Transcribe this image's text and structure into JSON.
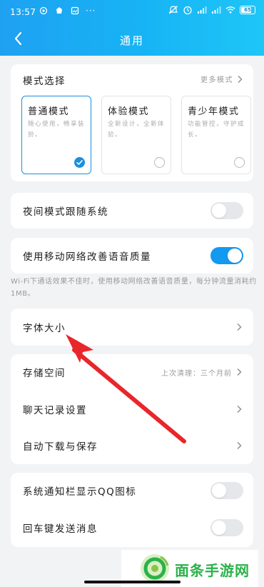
{
  "status": {
    "time": "13:57",
    "dots": "···",
    "battery": "65"
  },
  "nav": {
    "title": "通用",
    "back_icon": "chevron-left-icon"
  },
  "mode_select": {
    "title": "模式选择",
    "more": "更多模式",
    "modes": [
      {
        "name": "普通模式",
        "desc": "随心使用，畅享装扮。",
        "selected": true
      },
      {
        "name": "体验模式",
        "desc": "全新设计，全新体验。",
        "selected": false
      },
      {
        "name": "青少年模式",
        "desc": "功能管控，守护成长。",
        "selected": false
      }
    ]
  },
  "night_mode": {
    "label": "夜间模式跟随系统",
    "on": false
  },
  "mobile_voice": {
    "label": "使用移动网络改善语音质量",
    "on": true
  },
  "mobile_note": "Wi-Fi下通话效果不佳时，使用移动网络改善语音质量，每分钟流量消耗约1MB。",
  "font_size": {
    "label": "字体大小"
  },
  "storage": {
    "label": "存储空间",
    "value": "上次清理：三个月前"
  },
  "chat_history": {
    "label": "聊天记录设置"
  },
  "auto_download": {
    "label": "自动下载与保存"
  },
  "notif_icon": {
    "label": "系统通知栏显示QQ图标",
    "on": false
  },
  "enter_send": {
    "label": "回车键发送消息",
    "on": false
  },
  "watermark": {
    "text": "面条手游网"
  },
  "colors": {
    "accent": "#1299f0",
    "header": "#1ea1f1",
    "arrow": "#e8262b",
    "watermark": "#2bb24a"
  }
}
